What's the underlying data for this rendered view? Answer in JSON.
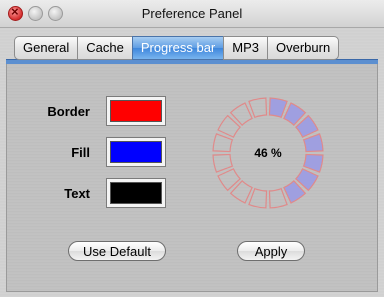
{
  "window": {
    "title": "Preference Panel"
  },
  "tabs": [
    {
      "label": "General"
    },
    {
      "label": "Cache"
    },
    {
      "label": "Progress bar"
    },
    {
      "label": "MP3"
    },
    {
      "label": "Overburn"
    }
  ],
  "active_tab": "Progress bar",
  "settings": {
    "border": {
      "label": "Border",
      "color": "#ff0000"
    },
    "fill": {
      "label": "Fill",
      "color": "#0000ff"
    },
    "text": {
      "label": "Text",
      "color": "#000000"
    }
  },
  "progress": {
    "percent_text": "46 %",
    "value": 0.46,
    "segments": 16,
    "segment_border_color": "#e08a8a",
    "segment_fill_color": "#9f9fe0"
  },
  "buttons": {
    "use_default": "Use Default",
    "apply": "Apply"
  }
}
